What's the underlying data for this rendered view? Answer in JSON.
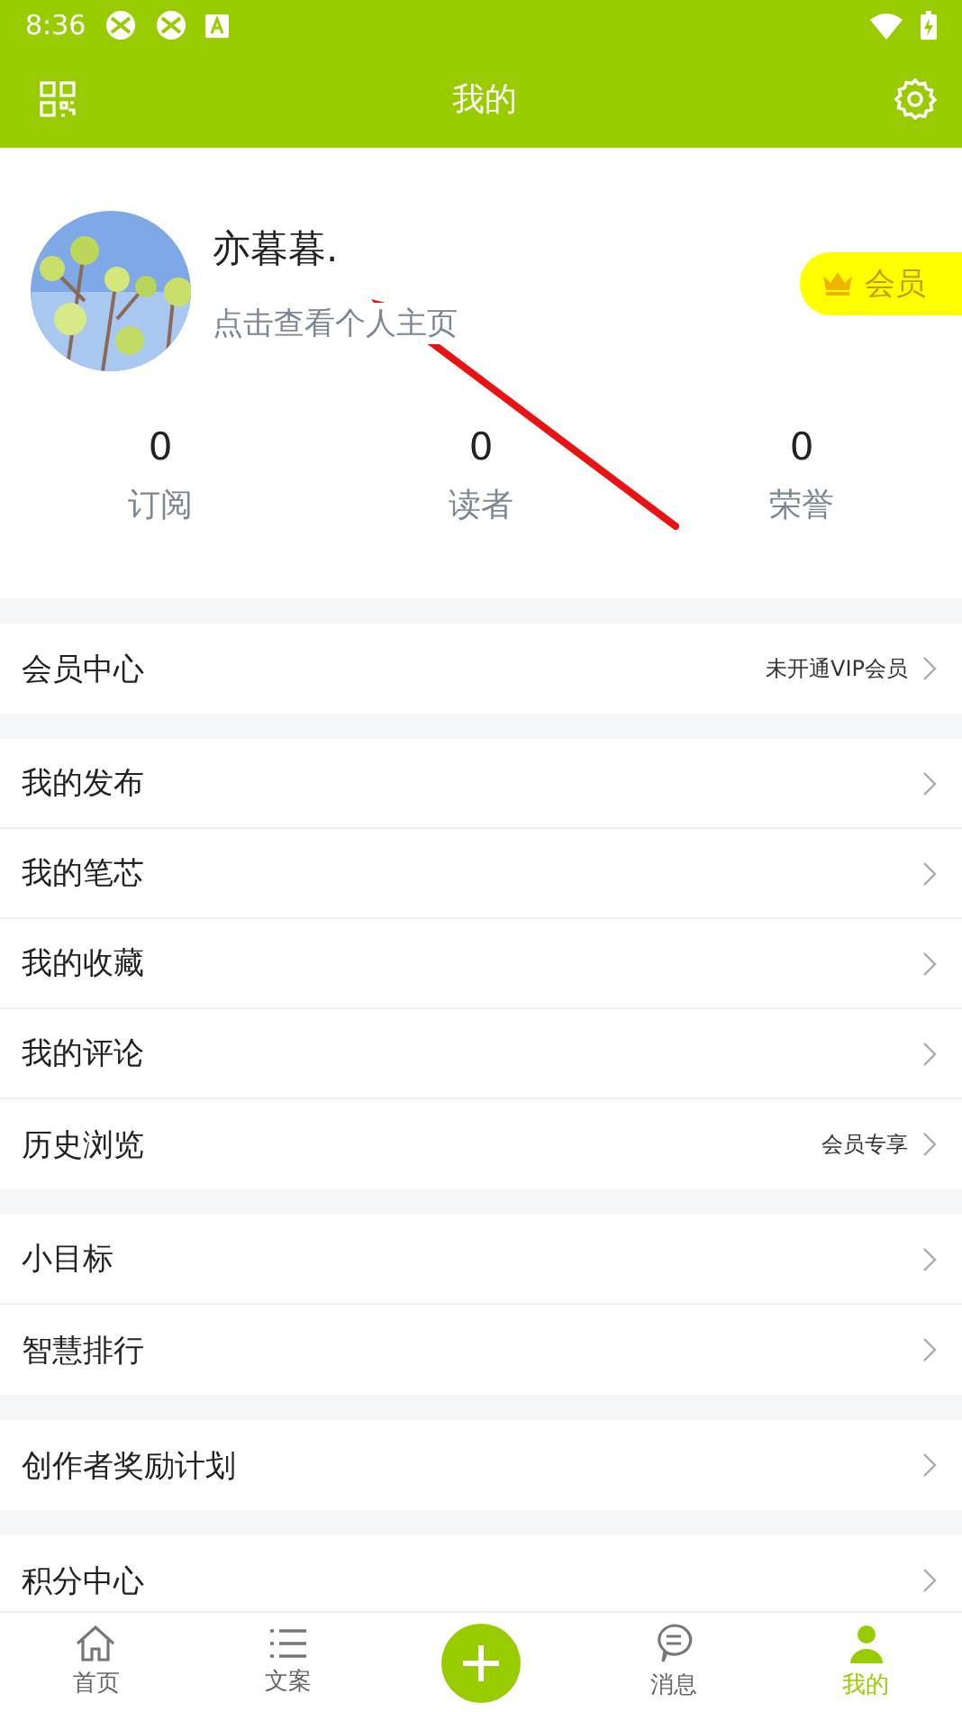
{
  "status_bar": {
    "time": "8:36"
  },
  "top_bar": {
    "title": "我的"
  },
  "profile": {
    "name": "亦暮暮.",
    "hint": "点击查看个人主页",
    "badge": "会员"
  },
  "stats": [
    {
      "value": "0",
      "label": "订阅"
    },
    {
      "value": "0",
      "label": "读者"
    },
    {
      "value": "0",
      "label": "荣誉"
    }
  ],
  "menu_groups": [
    {
      "items": [
        {
          "label": "会员中心",
          "detail": "未开通VIP会员"
        }
      ]
    },
    {
      "items": [
        {
          "label": "我的发布"
        },
        {
          "label": "我的笔芯"
        },
        {
          "label": "我的收藏"
        },
        {
          "label": "我的评论"
        },
        {
          "label": "历史浏览",
          "detail": "会员专享"
        }
      ]
    },
    {
      "items": [
        {
          "label": "小目标"
        },
        {
          "label": "智慧排行"
        }
      ]
    },
    {
      "items": [
        {
          "label": "创作者奖励计划"
        }
      ]
    },
    {
      "items": [
        {
          "label": "积分中心"
        }
      ]
    }
  ],
  "bottom_nav": [
    {
      "kind": "home",
      "label": "首页",
      "selected": false
    },
    {
      "kind": "list",
      "label": "文案",
      "selected": false
    },
    {
      "kind": "add",
      "selected": false
    },
    {
      "kind": "message",
      "label": "消息",
      "selected": false
    },
    {
      "kind": "profile",
      "label": "我的",
      "selected": true
    }
  ]
}
